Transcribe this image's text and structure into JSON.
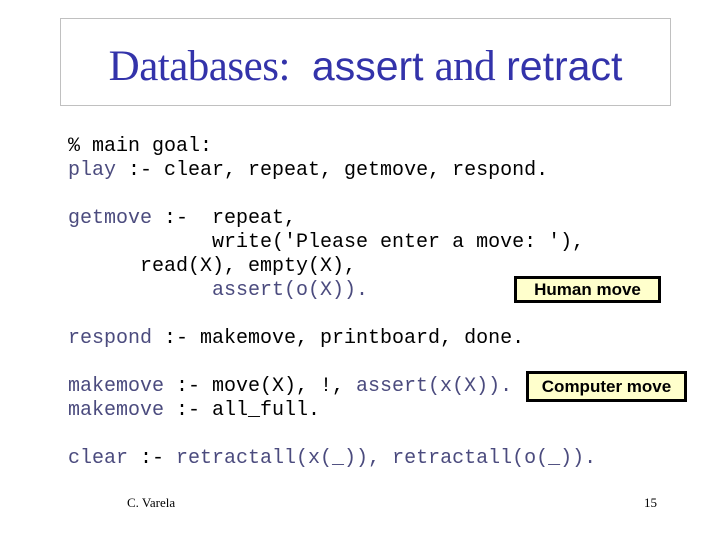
{
  "slide": {
    "title": {
      "part1": "Databases:",
      "part2": "assert",
      "part3": "and",
      "part4": "retract"
    },
    "colors": {
      "title": "#3333aa",
      "keyword": "#4b4b7e",
      "code": "#000000",
      "callout_fill": "#ffffcc",
      "callout_border": "#000000",
      "title_border": "#c0c0c0"
    },
    "code_lines": [
      {
        "segments": [
          {
            "text": "% main goal:",
            "style": "plain"
          }
        ]
      },
      {
        "segments": [
          {
            "text": "play",
            "style": "kw"
          },
          {
            "text": " :- clear, repeat, getmove, respond.",
            "style": "plain"
          }
        ]
      },
      {
        "segments": []
      },
      {
        "segments": [
          {
            "text": "getmove",
            "style": "kw"
          },
          {
            "text": " :-  repeat,",
            "style": "plain"
          }
        ]
      },
      {
        "segments": [
          {
            "text": "            write('Please enter a move: '),",
            "style": "plain"
          }
        ]
      },
      {
        "segments": [
          {
            "text": "      read(X), empty(X),",
            "style": "plain"
          }
        ]
      },
      {
        "segments": [
          {
            "text": "            ",
            "style": "plain"
          },
          {
            "text": "assert(o(X)).",
            "style": "kw"
          }
        ]
      },
      {
        "segments": []
      },
      {
        "segments": [
          {
            "text": "respond",
            "style": "kw"
          },
          {
            "text": " :- makemove, printboard, done.",
            "style": "plain"
          }
        ]
      },
      {
        "segments": []
      },
      {
        "segments": [
          {
            "text": "makemove",
            "style": "kw"
          },
          {
            "text": " :- move(X), !, ",
            "style": "plain"
          },
          {
            "text": "assert(x(X)).",
            "style": "kw"
          }
        ]
      },
      {
        "segments": [
          {
            "text": "makemove",
            "style": "kw"
          },
          {
            "text": " :- all_full.",
            "style": "plain"
          }
        ]
      },
      {
        "segments": []
      },
      {
        "segments": [
          {
            "text": "clear",
            "style": "kw"
          },
          {
            "text": " :- ",
            "style": "plain"
          },
          {
            "text": "retractall(x(_)), retractall(o(_)).",
            "style": "kw"
          }
        ]
      }
    ],
    "callouts": {
      "human": "Human move",
      "computer": "Computer move"
    },
    "footer": {
      "author": "C. Varela",
      "page_number": "15"
    }
  }
}
